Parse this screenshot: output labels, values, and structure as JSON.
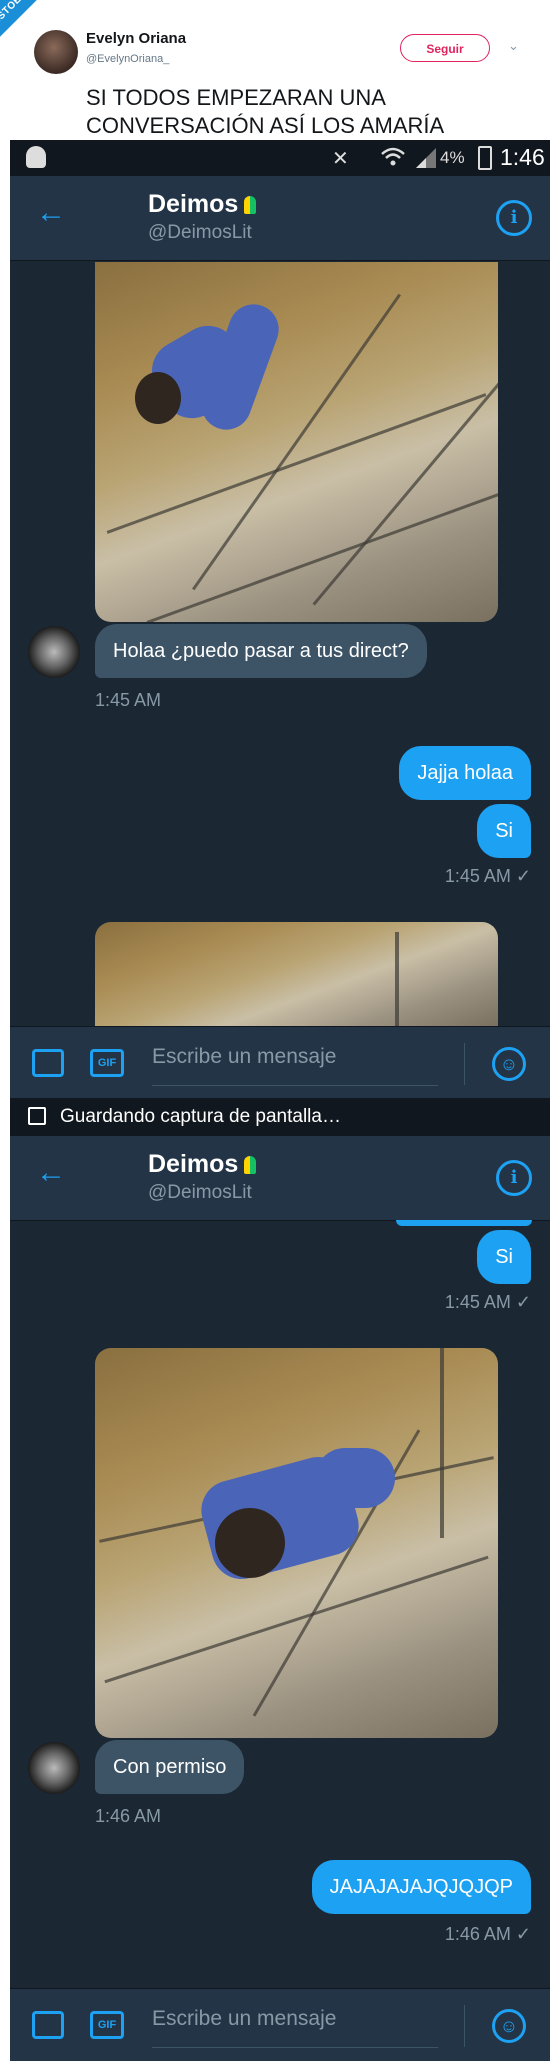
{
  "watermark": "VISTOENLASREDES .com",
  "tweet": {
    "author_name": "Evelyn Oriana",
    "author_handle": "@EvelynOriana_",
    "follow_label": "Seguir",
    "text": "SI TODOS EMPEZARAN UNA CONVERSACIÓN ASÍ LOS AMARÍA"
  },
  "status_bar": {
    "battery": "4%",
    "time": "1:46"
  },
  "chat": {
    "name": "Deimos",
    "handle": "@DeimosLit",
    "info_icon": "i"
  },
  "screen1": {
    "messages": [
      {
        "text": "Holaa ¿puedo pasar a tus direct?",
        "time": "1:45 AM"
      },
      {
        "text": "Jajja holaa"
      },
      {
        "text": "Si",
        "time": "1:45 AM ✓"
      }
    ]
  },
  "composer": {
    "gif_label": "GIF",
    "placeholder": "Escribe un mensaje"
  },
  "saving_notice": "Guardando captura de pantalla…",
  "screen2": {
    "messages": [
      {
        "text": "Si",
        "time": "1:45 AM ✓"
      },
      {
        "text": "Con permiso",
        "time": "1:46 AM"
      },
      {
        "text": "JAJAJAJAJQJQJQP",
        "time": "1:46 AM ✓"
      }
    ]
  },
  "colors": {
    "accent": "#1da1f2",
    "background": "#1b2733",
    "bar": "#243447",
    "incoming_bubble": "#3d5466",
    "follow": "#e0245e"
  }
}
